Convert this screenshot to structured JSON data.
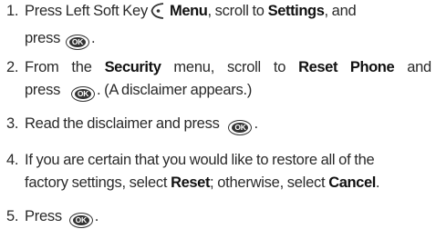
{
  "icons": {
    "ok_key": "OK",
    "left_soft_key": "left-soft-key-icon"
  },
  "steps": [
    {
      "number": "1.",
      "line1": {
        "t1": "Press Left Soft Key",
        "b1": "Menu",
        "t2": ", scroll to",
        "b2": "Settings",
        "t3": ", and"
      },
      "line2": {
        "t1": "press",
        "t2": "."
      }
    },
    {
      "number": "2.",
      "line1": {
        "t1": "From the",
        "b1": "Security",
        "t2": "menu, scroll to",
        "b2": "Reset Phone",
        "t3": "and"
      },
      "line2": {
        "t1": "press",
        "t2": ". (A disclaimer appears.)"
      }
    },
    {
      "number": "3.",
      "line1": {
        "t1": "Read the disclaimer and press",
        "t2": "."
      }
    },
    {
      "number": "4.",
      "line1": {
        "t1": "If you are certain that you would like to restore all of the"
      },
      "line2": {
        "t1": "factory settings, select",
        "b1": "Reset",
        "t2": "; otherwise, select",
        "b2": "Cancel",
        "t3": "."
      }
    },
    {
      "number": "5.",
      "line1": {
        "t1": "Press",
        "t2": "."
      }
    }
  ]
}
